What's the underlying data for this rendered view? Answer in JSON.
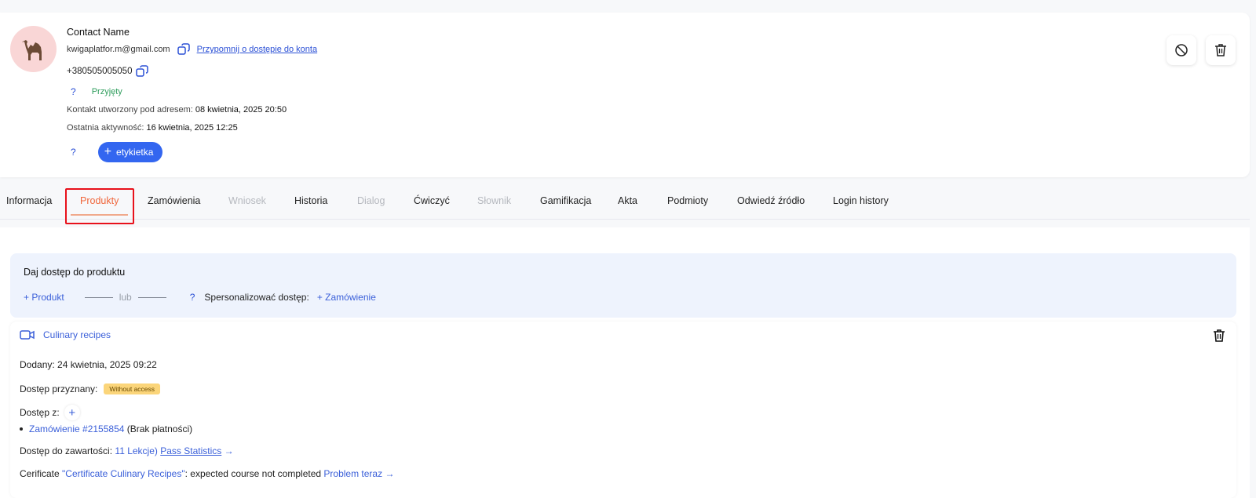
{
  "contact": {
    "name": "Contact Name",
    "email": "kwigaplatfor.m@gmail.com",
    "reminder_link": "Przypomnij o dostępie do konta",
    "phone": "+380505005050",
    "question_mark": "?",
    "status": "Przyjęty",
    "created_label": "Kontakt utworzony pod adresem:",
    "created_value": "08 kwietnia, 2025 20:50",
    "activity_label": "Ostatnia aktywność:",
    "activity_value": "16 kwietnia, 2025 12:25",
    "tag_button": "etykietka",
    "avatar_icon": "camel-icon",
    "block_icon": "block-icon",
    "delete_icon": "trash-icon"
  },
  "tabs": [
    {
      "label": "Informacja",
      "state": "normal"
    },
    {
      "label": "Produkty",
      "state": "active"
    },
    {
      "label": "Zamówienia",
      "state": "normal"
    },
    {
      "label": "Wniosek",
      "state": "disabled"
    },
    {
      "label": "Historia",
      "state": "normal"
    },
    {
      "label": "Dialog",
      "state": "disabled"
    },
    {
      "label": "Ćwiczyć",
      "state": "normal"
    },
    {
      "label": "Słownik",
      "state": "disabled"
    },
    {
      "label": "Gamifikacja",
      "state": "normal"
    },
    {
      "label": "Akta",
      "state": "normal"
    },
    {
      "label": "Podmioty",
      "state": "normal"
    },
    {
      "label": "Odwiedź źródło",
      "state": "normal"
    },
    {
      "label": "Login history",
      "state": "normal"
    }
  ],
  "access": {
    "title": "Daj dostęp do produktu",
    "add_product": "+ Produkt",
    "or": "lub",
    "question_mark": "?",
    "personalize": "Spersonalizować dostęp:",
    "add_order": "+ Zamówienie"
  },
  "product": {
    "name": "Culinary recipes",
    "icon": "video-camera-icon",
    "added_label": "Dodany:",
    "added_value": "24 kwietnia, 2025 09:22",
    "granted_label": "Dostęp przyznany:",
    "granted_badge": "Without access",
    "access_from_label": "Dostęp z:",
    "order_link": "Zamówienie #2155854",
    "order_note": "(Brak płatności)",
    "content_label": "Dostęp do zawartości:",
    "lessons_link": "11 Lekcje)",
    "stats_link": "Pass Statistics",
    "arrow": "→",
    "cert_prefix": "Cerificate",
    "cert_name": "\"Certificate Culinary Recipes\"",
    "cert_text": ": expected course not completed",
    "problem_link": "Problem teraz",
    "colors": {
      "accent": "#3366f0",
      "active_tab": "#f0663b",
      "badge": "#fbd57a",
      "status_green": "#2e9d5c"
    }
  }
}
